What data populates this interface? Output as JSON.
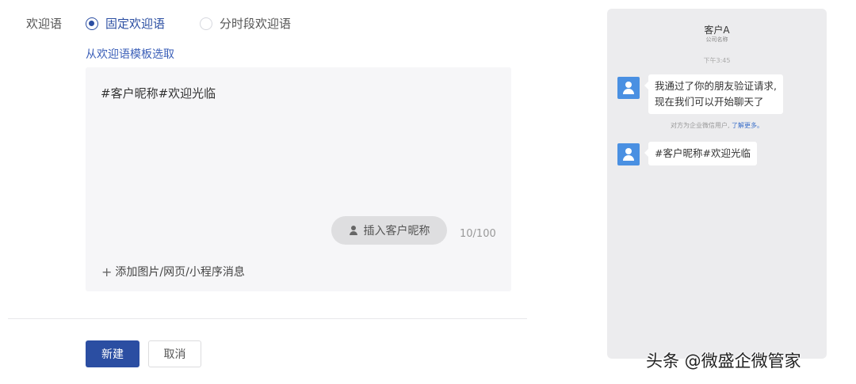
{
  "form": {
    "label": "欢迎语",
    "options": [
      {
        "label": "固定欢迎语",
        "checked": true
      },
      {
        "label": "分时段欢迎语",
        "checked": false
      }
    ],
    "template_link": "从欢迎语模板选取"
  },
  "editor": {
    "content": "#客户昵称#欢迎光临",
    "insert_button": "插入客户昵称",
    "counter": "10/100",
    "add_media_icon": "+",
    "add_media": "添加图片/网页/小程序消息"
  },
  "actions": {
    "create": "新建",
    "cancel": "取消"
  },
  "preview": {
    "contact_name": "客户A",
    "company": "公司名称",
    "time": "下午3:45",
    "messages": [
      {
        "line1": "我通过了你的朋友验证请求,",
        "line2": "现在我们可以开始聊天了"
      },
      {
        "line1": "#客户昵称#欢迎光临"
      }
    ],
    "notice_text": "对方为企业微信用户,",
    "notice_link": "了解更多。"
  },
  "watermark": "头条 @微盛企微管家",
  "colors": {
    "accent": "#2b4ea2",
    "link": "#3b5fb8",
    "avatar": "#4a90e2"
  },
  "icons": [
    "radio-checked-icon",
    "radio-unchecked-icon",
    "person-icon",
    "plus-icon",
    "avatar-icon"
  ]
}
